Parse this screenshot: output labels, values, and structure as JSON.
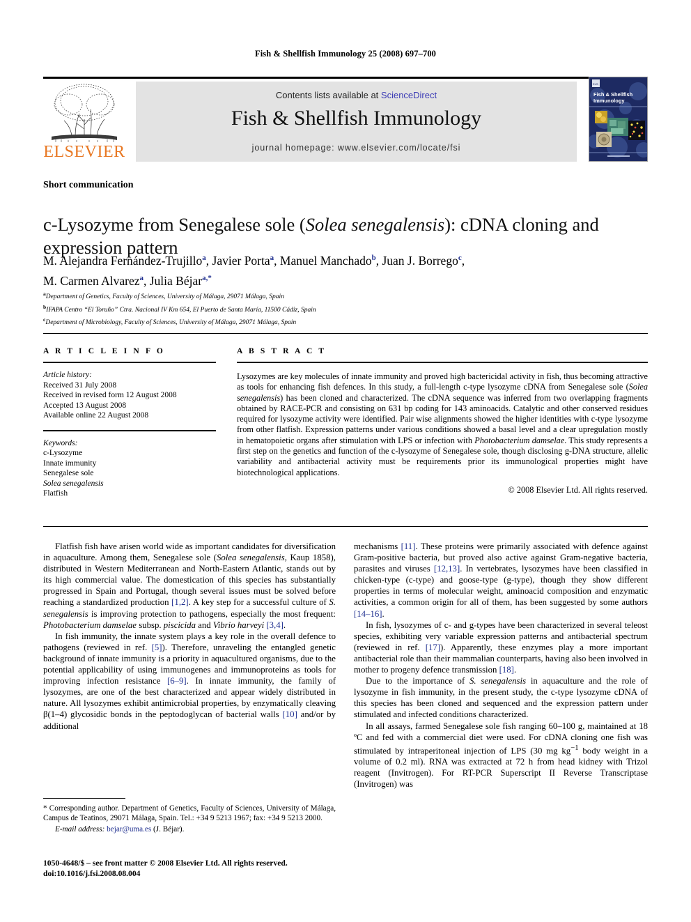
{
  "running_head": "Fish & Shellfish Immunology 25 (2008) 697–700",
  "masthead": {
    "publisher_name": "ELSEVIER",
    "contents_prefix": "Contents lists available at ",
    "contents_link": "ScienceDirect",
    "journal_title": "Fish & Shellfish Immunology",
    "homepage": "journal homepage: www.elsevier.com/locate/fsi",
    "cover_title_line1": "Fish & Shellfish",
    "cover_title_line2": "Immunology"
  },
  "article": {
    "section_label": "Short communication",
    "title_part1": "c-Lysozyme from Senegalese sole (",
    "title_italic": "Solea senegalensis",
    "title_part2": "): cDNA cloning and expression pattern",
    "authors": [
      {
        "name": "M. Alejandra Fernández-Trujillo",
        "sup": "a",
        "sep": ", "
      },
      {
        "name": "Javier Porta",
        "sup": "a",
        "sep": ", "
      },
      {
        "name": "Manuel Manchado",
        "sup": "b",
        "sep": ", "
      },
      {
        "name": "Juan J. Borrego",
        "sup": "c",
        "sep": ","
      },
      {
        "name": "M. Carmen Alvarez",
        "sup": "a",
        "sep": ", "
      },
      {
        "name": "Julia Béjar",
        "sup": "a,*",
        "sep": ""
      }
    ],
    "affiliations": [
      {
        "mark": "a",
        "text": "Department of Genetics, Faculty of Sciences, University of Málaga, 29071 Málaga, Spain"
      },
      {
        "mark": "b",
        "text": "IFAPA Centro “El Toruño” Ctra. Nacional IV Km 654, El Puerto de Santa María, 11500 Cádiz, Spain"
      },
      {
        "mark": "c",
        "text": "Department of Microbiology, Faculty of Sciences, University of Málaga, 29071 Málaga, Spain"
      }
    ]
  },
  "article_info": {
    "heading": "A R T I C L E  I N F O",
    "history_label": "Article history:",
    "history": [
      "Received 31 July 2008",
      "Received in revised form 12 August 2008",
      "Accepted 13 August 2008",
      "Available online 22 August 2008"
    ],
    "keywords_label": "Keywords:",
    "keywords": [
      "c-Lysozyme",
      "Innate immunity",
      "Senegalese sole",
      "Solea senegalensis",
      "Flatfish"
    ],
    "keyword_italic_index": 3
  },
  "abstract": {
    "heading": "A B S T R A C T",
    "text_1": "Lysozymes are key molecules of innate immunity and proved high bactericidal activity in fish, thus becoming attractive as tools for enhancing fish defences. In this study, a full-length c-type lysozyme cDNA from Senegalese sole (",
    "species_1": "Solea senegalensis",
    "text_2": ") has been cloned and characterized. The cDNA sequence was inferred from two overlapping fragments obtained by RACE-PCR and consisting on 631 bp coding for 143 aminoacids. Catalytic and other conserved residues required for lysozyme activity were identified. Pair wise alignments showed the higher identities with c-type lysozyme from other flatfish. Expression patterns under various conditions showed a basal level and a clear upregulation mostly in hematopoietic organs after stimulation with LPS or infection with ",
    "species_2": "Photobacterium damselae",
    "text_3": ". This study represents a first step on the genetics and function of the c-lysozyme of Senegalese sole, though disclosing g-DNA structure, allelic variability and antibacterial activity must be requirements prior its immunological properties might have biotechnological applications.",
    "copyright": "© 2008 Elsevier Ltd. All rights reserved."
  },
  "body": {
    "left": {
      "p1_a": "Flatfish fish have arisen world wide as important candidates for diversification in aquaculture. Among them, Senegalese sole (",
      "p1_sp1": "Solea senegalensis",
      "p1_b": ", Kaup 1858), distributed in Western Mediterranean and North-Eastern Atlantic, stands out by its high commercial value. The domestication of this species has substantially progressed in Spain and Portugal, though several issues must be solved before reaching a standardized production ",
      "p1_ref1": "[1,2]",
      "p1_c": ". A key step for a successful culture of ",
      "p1_sp2": "S. senegalensis",
      "p1_d": " is improving protection to pathogens, especially the most frequent: ",
      "p1_sp3": "Photobacterium damselae",
      "p1_e": " subsp. ",
      "p1_sp4": "piscicida",
      "p1_f": " and ",
      "p1_sp5": "Vibrio harveyi",
      "p1_g": " ",
      "p1_ref2": "[3,4]",
      "p1_h": ".",
      "p2_a": "In fish immunity, the innate system plays a key role in the overall defence to pathogens (reviewed in ref. ",
      "p2_ref1": "[5]",
      "p2_b": "). Therefore, unraveling the entangled genetic background of innate immunity is a priority in aquacultured organisms, due to the potential applicability of using immunogenes and immunoproteins as tools for improving infection resistance ",
      "p2_ref2": "[6–9]",
      "p2_c": ". In innate immunity, the family of lysozymes, are one of the best characterized and appear widely distributed in nature. All lysozymes exhibit antimicrobial properties, by enzymatically cleaving β(1–4) glycosidic bonds in the peptodoglycan of bacterial walls ",
      "p2_ref3": "[10]",
      "p2_d": " and/or by additional"
    },
    "right": {
      "p3_a": "mechanisms ",
      "p3_ref1": "[11]",
      "p3_b": ". These proteins were primarily associated with defence against Gram-positive bacteria, but proved also active against Gram-negative bacteria, parasites and viruses ",
      "p3_ref2": "[12,13]",
      "p3_c": ". In vertebrates, lysozymes have been classified in chicken-type (c-type) and goose-type (g-type), though they show different properties in terms of molecular weight, aminoacid composition and enzymatic activities, a common origin for all of them, has been suggested by some authors ",
      "p3_ref3": "[14–16]",
      "p3_d": ".",
      "p4_a": "In fish, lysozymes of c- and g-types have been characterized in several teleost species, exhibiting very variable expression patterns and antibacterial spectrum (reviewed in ref. ",
      "p4_ref1": "[17]",
      "p4_b": "). Apparently, these enzymes play a more important antibacterial role than their mammalian counterparts, having also been involved in mother to progeny defence transmission ",
      "p4_ref2": "[18]",
      "p4_c": ".",
      "p5_a": "Due to the importance of ",
      "p5_sp1": "S. senegalensis",
      "p5_b": " in aquaculture and the role of lysozyme in fish immunity, in the present study, the c-type lysozyme cDNA of this species has been cloned and sequenced and the expression pattern under stimulated and infected conditions characterized.",
      "p6_a": "In all assays, farmed Senegalese sole fish ranging 60–100 g, maintained at 18 ºC and fed with a commercial diet were used. For cDNA cloning one fish was stimulated by intraperitoneal injection of LPS (30 mg kg",
      "p6_sup": "−1",
      "p6_b": " body weight in a volume of 0.2 ml). RNA was extracted at 72 h from head kidney with Trizol reagent (Invitrogen). For RT-PCR Superscript II Reverse Transcriptase (Invitrogen) was"
    }
  },
  "footnote": {
    "corresponding": "* Corresponding author. Department of Genetics, Faculty of Sciences, University of Málaga, Campus de Teatinos, 29071 Málaga, Spain. Tel.: +34 9 5213 1967; fax: +34 9 5213 2000.",
    "email_label": "E-mail address:",
    "email": "bejar@uma.es",
    "email_suffix": "(J. Béjar)."
  },
  "footer": {
    "issn_line": "1050-4648/$ – see front matter © 2008 Elsevier Ltd. All rights reserved.",
    "doi_line": "doi:10.1016/j.fsi.2008.08.004"
  },
  "colors": {
    "link": "#3b3bb5",
    "reference": "#1f2f8f",
    "elsevier_orange": "#e87722",
    "band_grey": "#e3e3e3",
    "cover_blue": "#1d2a62"
  }
}
